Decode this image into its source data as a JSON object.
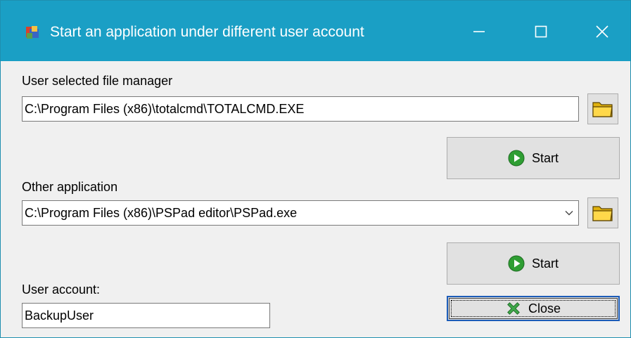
{
  "window": {
    "title": "Start an application under different user account",
    "titlebar_color": "#1a9fc5",
    "icons": {
      "app": "app-shield-icon",
      "minimize": "minimize-icon",
      "maximize": "maximize-icon",
      "close": "close-icon"
    }
  },
  "file_manager": {
    "label": "User selected file manager",
    "path": "C:\\Program Files (x86)\\totalcmd\\TOTALCMD.EXE",
    "browse_icon": "folder-icon",
    "start_label": "Start",
    "start_icon": "play-icon"
  },
  "other_app": {
    "label": "Other application",
    "path": "C:\\Program Files (x86)\\PSPad editor\\PSPad.exe",
    "browse_icon": "folder-icon",
    "dropdown_icon": "chevron-down-icon",
    "start_label": "Start",
    "start_icon": "play-icon"
  },
  "user_account": {
    "label": "User account:",
    "value": "BackupUser"
  },
  "close_button": {
    "label": "Close",
    "icon": "x-mark-icon"
  }
}
